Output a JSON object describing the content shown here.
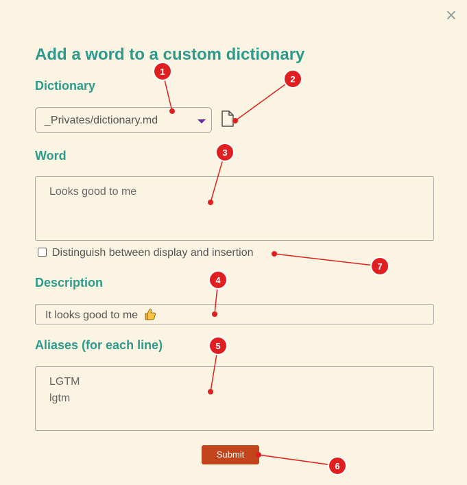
{
  "dialog": {
    "close_symbol": "×",
    "title": "Add a word to a custom dictionary"
  },
  "dictionary": {
    "label": "Dictionary",
    "selected": "_Privates/dictionary.md"
  },
  "word": {
    "label": "Word",
    "value": "Looks good to me"
  },
  "distinguish": {
    "label": "Distinguish between display and insertion",
    "checked": false
  },
  "description": {
    "label": "Description",
    "value": "It looks good to me"
  },
  "aliases": {
    "label": "Aliases (for each line)",
    "lines": [
      "LGTM",
      "lgtm"
    ]
  },
  "submit": {
    "label": "Submit"
  },
  "annotations": [
    "1",
    "2",
    "3",
    "4",
    "5",
    "6",
    "7"
  ],
  "colors": {
    "background": "#fbf4e2",
    "accent_teal": "#2c9a8c",
    "submit_bg": "#c2441b",
    "caret": "#6a2f9e",
    "annotation_red": "#e02020"
  }
}
